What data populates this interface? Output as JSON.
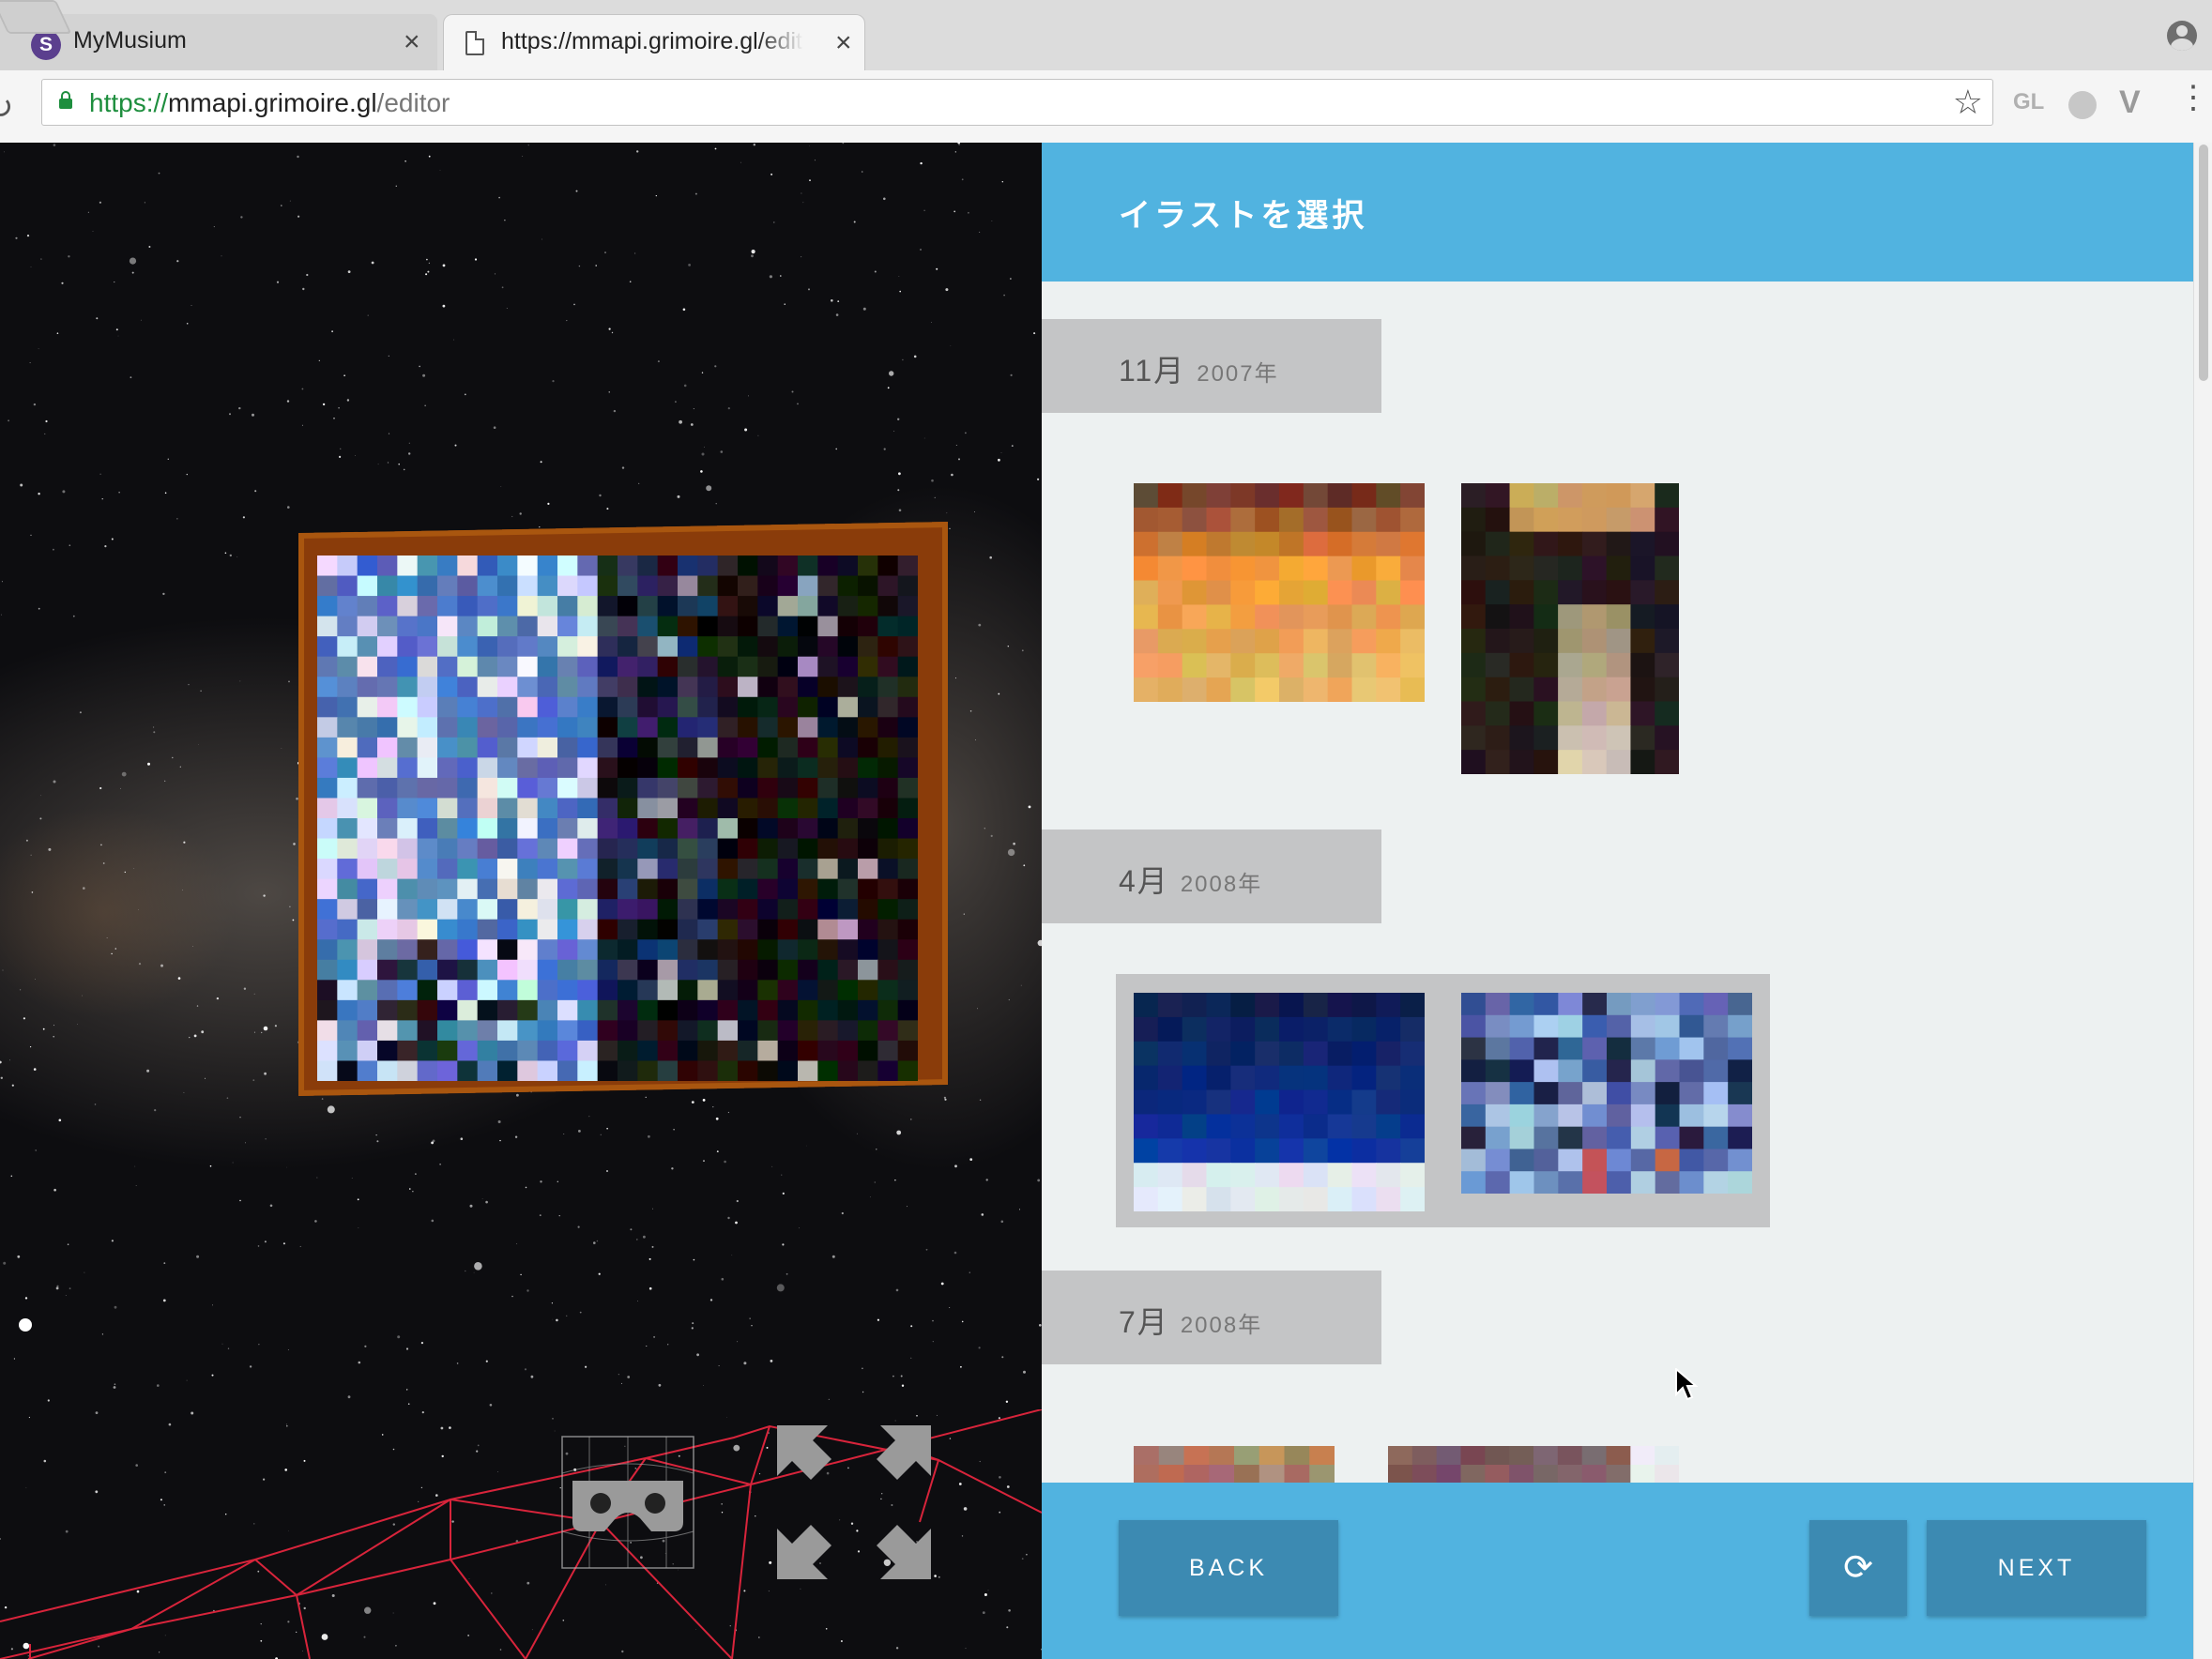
{
  "browser": {
    "tabs": [
      {
        "title": "MyMusium",
        "favicon": "S",
        "active": false
      },
      {
        "title": "https://mmapi.grimoire.gl/editor",
        "active": true
      }
    ],
    "url": {
      "scheme": "https://",
      "host": "mmapi.grimoire.gl",
      "path": "/editor"
    },
    "extensions": [
      "GL",
      "circle-extension-icon",
      "vue-devtools-icon"
    ]
  },
  "panel": {
    "title": "イラストを選択",
    "groups": [
      {
        "month": "11月",
        "year": "2007年",
        "thumbnails": [
          "sunset-orange-artwork",
          "dark-figure-artwork"
        ],
        "selected": false
      },
      {
        "month": "4月",
        "year": "2008年",
        "thumbnails": [
          "deep-blue-night-artwork",
          "blue-mosaic-artwork"
        ],
        "selected": true
      },
      {
        "month": "7月",
        "year": "2008年",
        "thumbnails": [
          "tan-artwork",
          "mauve-artwork"
        ],
        "selected": false
      }
    ]
  },
  "footer": {
    "back_label": "BACK",
    "reload_label": "⟳",
    "next_label": "NEXT"
  },
  "colors": {
    "accent": "#51b3e0",
    "button": "#3c8ab2",
    "panel_bg": "#edf1f1",
    "label_bg": "#c4c5c6"
  }
}
